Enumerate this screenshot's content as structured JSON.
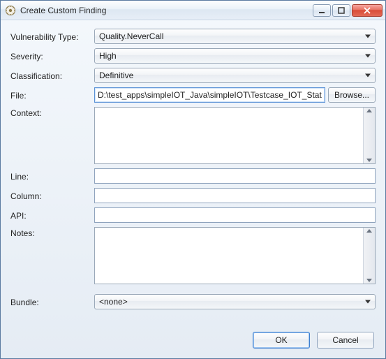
{
  "window": {
    "title": "Create Custom Finding"
  },
  "labels": {
    "vulnType": "Vulnerability Type:",
    "severity": "Severity:",
    "classification": "Classification:",
    "file": "File:",
    "context": "Context:",
    "line": "Line:",
    "column": "Column:",
    "api": "API:",
    "notes": "Notes:",
    "bundle": "Bundle:"
  },
  "values": {
    "vulnType": "Quality.NeverCall",
    "severity": "High",
    "classification": "Definitive",
    "file": "D:\\test_apps\\simpleIOT_Java\\simpleIOT\\Testcase_IOT_Static.ja",
    "context": "",
    "line": "",
    "column": "",
    "api": "",
    "notes": "",
    "bundle": "<none>"
  },
  "buttons": {
    "browse": "Browse...",
    "ok": "OK",
    "cancel": "Cancel"
  }
}
